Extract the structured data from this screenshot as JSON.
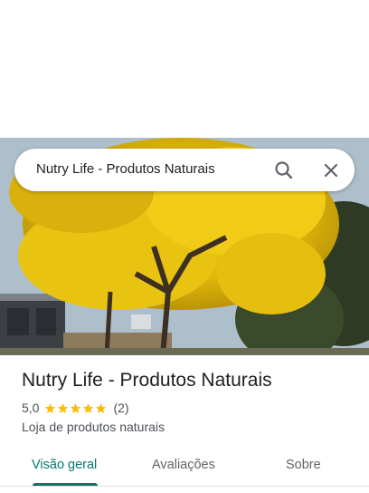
{
  "search": {
    "query": "Nutry Life - Produtos Naturais",
    "search_icon": "search-icon",
    "close_icon": "close-icon"
  },
  "place": {
    "name": "Nutry Life - Produtos Naturais",
    "rating": "5,0",
    "stars": 5,
    "review_count": "(2)",
    "category": "Loja de produtos naturais"
  },
  "tabs": [
    {
      "label": "Visão geral",
      "active": true
    },
    {
      "label": "Avaliações",
      "active": false
    },
    {
      "label": "Sobre",
      "active": false
    }
  ],
  "colors": {
    "accent": "#00796b",
    "star": "#fbbc04",
    "text_primary": "#202124",
    "text_secondary": "#4d5156"
  }
}
